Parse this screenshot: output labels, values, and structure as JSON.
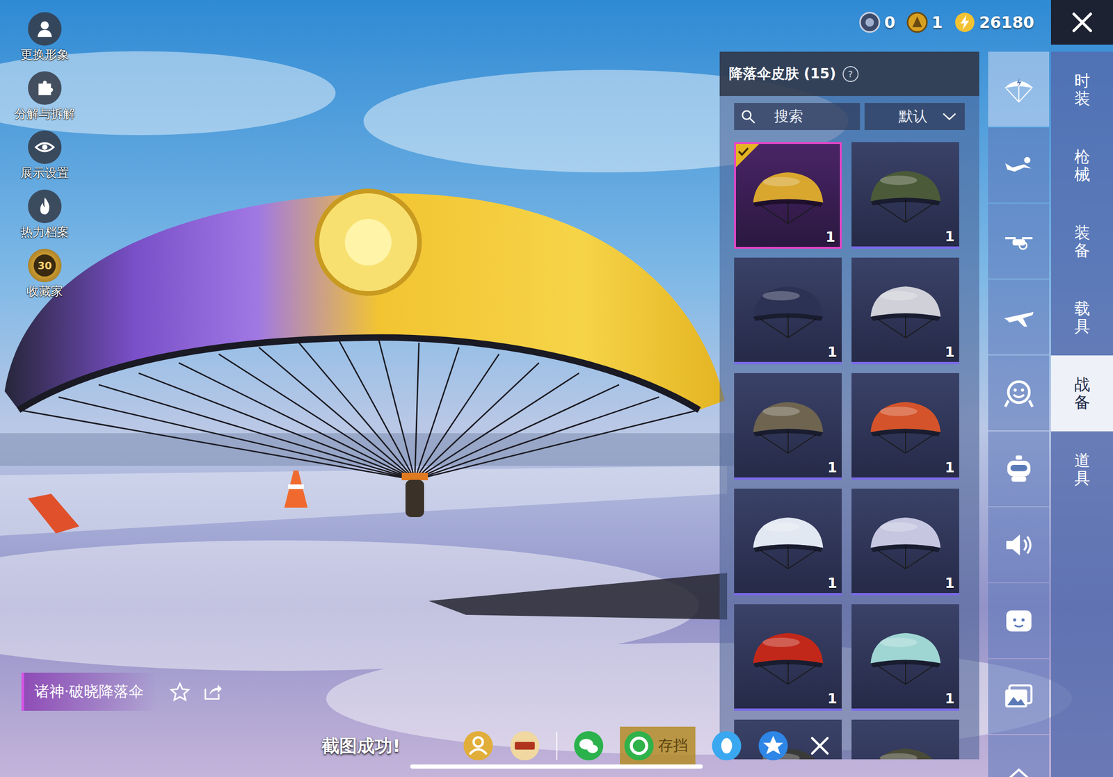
{
  "top_bar": {
    "currencies": [
      {
        "kind": "token",
        "amount": "0"
      },
      {
        "kind": "coin",
        "amount": "1"
      },
      {
        "kind": "energy",
        "amount": "26180"
      }
    ]
  },
  "left_menu": [
    {
      "label": "更换形象",
      "kind": "avatar"
    },
    {
      "label": "分解与拆解",
      "kind": "puzzle"
    },
    {
      "label": "展示设置",
      "kind": "eye"
    },
    {
      "label": "热力档案",
      "kind": "flame"
    },
    {
      "label": "收藏家",
      "kind": "collector",
      "badge": "30"
    }
  ],
  "panel": {
    "title": "降落伞皮肤 (15)",
    "help": "?",
    "search": {
      "placeholder": "搜索"
    },
    "sort": {
      "value": "默认"
    },
    "items": [
      {
        "count": "1",
        "selected": true,
        "color": "#d9a62e"
      },
      {
        "count": "1",
        "selected": false,
        "color": "#4b5a38"
      },
      {
        "count": "1",
        "selected": false,
        "color": "#2c3254"
      },
      {
        "count": "1",
        "selected": false,
        "color": "#cfd0d8"
      },
      {
        "count": "1",
        "selected": false,
        "color": "#6e6450"
      },
      {
        "count": "1",
        "selected": false,
        "color": "#d4532a"
      },
      {
        "count": "1",
        "selected": false,
        "color": "#e2e8f2"
      },
      {
        "count": "1",
        "selected": false,
        "color": "#c6c6e0"
      },
      {
        "count": "1",
        "selected": false,
        "color": "#c2281a"
      },
      {
        "count": "1",
        "selected": false,
        "color": "#9fd6d4"
      },
      {
        "selected": false,
        "color": "#3a3a3a"
      },
      {
        "selected": false,
        "color": "#4a4a38"
      }
    ]
  },
  "icon_tabs": [
    {
      "kind": "parachute",
      "selected": true
    },
    {
      "kind": "skydive",
      "selected": false
    },
    {
      "kind": "drone",
      "selected": false
    },
    {
      "kind": "plane",
      "selected": false
    },
    {
      "kind": "emote",
      "selected": false
    },
    {
      "kind": "mascot",
      "selected": false
    },
    {
      "kind": "sound",
      "selected": false
    },
    {
      "kind": "sticker",
      "selected": false
    },
    {
      "kind": "photo",
      "selected": false
    },
    {
      "kind": "more",
      "selected": false
    }
  ],
  "categories": [
    {
      "label": "时装",
      "selected": false
    },
    {
      "label": "枪械",
      "selected": false
    },
    {
      "label": "装备",
      "selected": false
    },
    {
      "label": "载具",
      "selected": false
    },
    {
      "label": "战备",
      "selected": true
    },
    {
      "label": "道具",
      "selected": false
    }
  ],
  "preview": {
    "name": "诸神·破晓降落伞"
  },
  "toast": "截图成功!",
  "share": [
    {
      "kind": "profile"
    },
    {
      "kind": "game"
    },
    {
      "kind": "divider"
    },
    {
      "kind": "wechat"
    },
    {
      "kind": "save",
      "label": "存挡"
    },
    {
      "kind": "qq"
    },
    {
      "kind": "qzone"
    },
    {
      "kind": "close"
    }
  ]
}
